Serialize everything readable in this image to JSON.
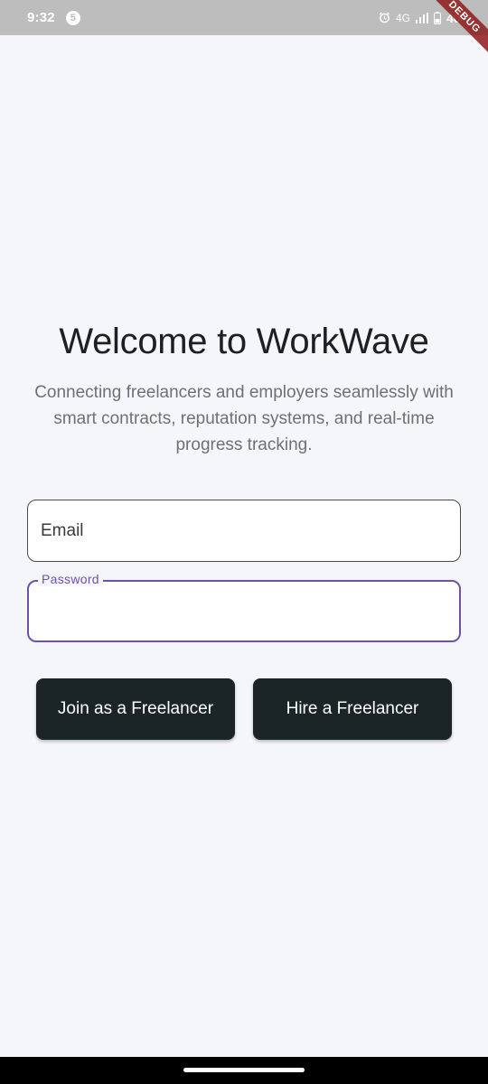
{
  "status_bar": {
    "time": "9:32",
    "notification_count": "5",
    "network": "4G",
    "battery_percent": "40%"
  },
  "debug_banner": "DEBUG",
  "welcome": {
    "title": "Welcome to WorkWave",
    "subtitle": "Connecting freelancers and employers seamlessly with smart contracts, reputation systems, and real-time progress tracking."
  },
  "form": {
    "email_placeholder": "Email",
    "email_value": "",
    "password_label": "Password",
    "password_value": ""
  },
  "actions": {
    "freelancer_label": "Join as a Freelancer",
    "hire_label": "Hire a Freelancer"
  },
  "colors": {
    "background": "#f5f6fa",
    "primary_button": "#1c2526",
    "focus_accent": "#6f52a8",
    "status_bar": "#bdbdbd"
  }
}
